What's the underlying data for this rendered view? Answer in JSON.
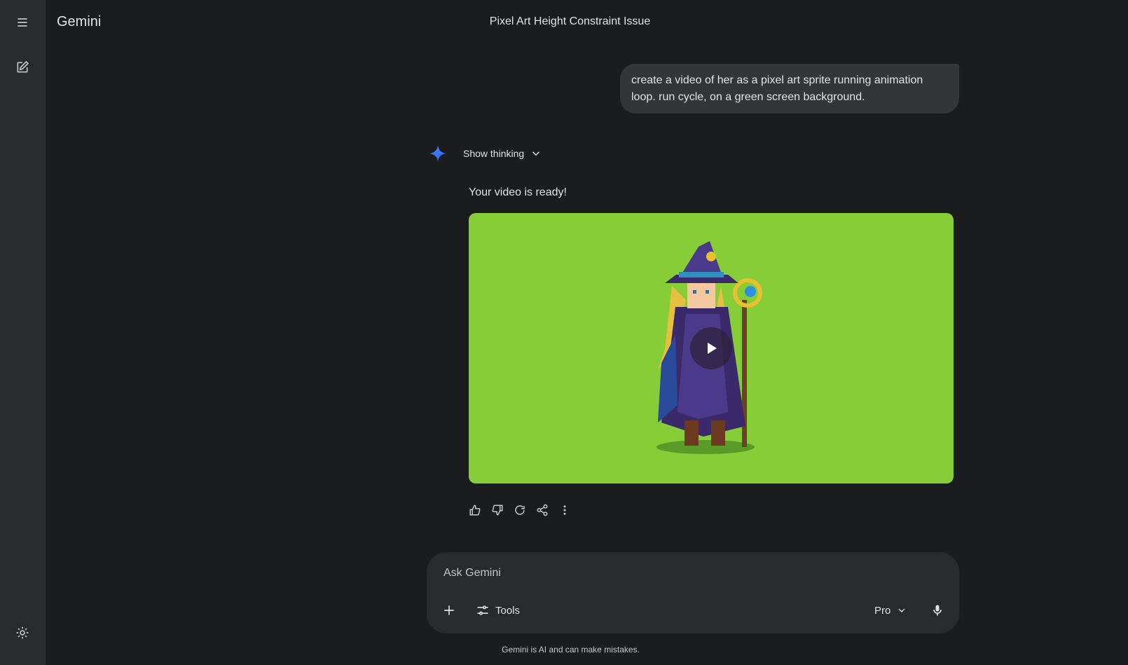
{
  "app": {
    "name": "Gemini"
  },
  "conversation": {
    "title": "Pixel Art Height Constraint Issue"
  },
  "user_message": {
    "text": "create a video of her as a pixel art sprite running animation loop. run cycle, on a green screen background."
  },
  "response": {
    "show_thinking_label": "Show thinking",
    "text": "Your video is ready!",
    "video": {
      "background_color": "#86cd37",
      "icon": "play-icon"
    }
  },
  "response_actions": [
    "thumb-up-icon",
    "thumb-down-icon",
    "regenerate-icon",
    "share-icon",
    "more-vert-icon"
  ],
  "composer": {
    "placeholder": "Ask Gemini",
    "tools_label": "Tools",
    "model_label": "Pro"
  },
  "disclaimer": "Gemini is AI and can make mistakes.",
  "colors": {
    "background": "#1b1c1d",
    "rail": "#282a2c",
    "bubble": "#333537",
    "composer": "#282a2c",
    "accent": "#4285f4"
  }
}
